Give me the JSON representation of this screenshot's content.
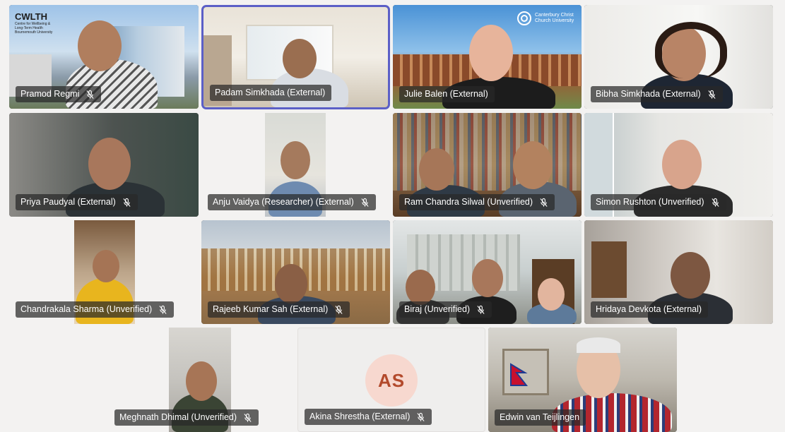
{
  "participants": [
    {
      "name": "Pramod Regmi",
      "muted": true
    },
    {
      "name": "Padam Simkhada (External)",
      "muted": false,
      "active_speaker": true
    },
    {
      "name": "Julie Balen (External)",
      "muted": false
    },
    {
      "name": "Bibha Simkhada (External)",
      "muted": true
    },
    {
      "name": "Priya Paudyal (External)",
      "muted": true
    },
    {
      "name": "Anju Vaidya (Researcher) (External)",
      "muted": true
    },
    {
      "name": "Ram Chandra Silwal (Unverified)",
      "muted": true
    },
    {
      "name": "Simon Rushton (Unverified)",
      "muted": true
    },
    {
      "name": "Chandrakala Sharma (Unverified)",
      "muted": true
    },
    {
      "name": "Rajeeb Kumar Sah (External)",
      "muted": true
    },
    {
      "name": "Biraj (Unverified)",
      "muted": true
    },
    {
      "name": "Hridaya Devkota (External)",
      "muted": false
    },
    {
      "name": "Meghnath Dhimal (Unverified)",
      "muted": true
    },
    {
      "name": "Akina Shrestha (External)",
      "muted": true,
      "initials": "AS"
    },
    {
      "name": "Edwin van Teijlingen",
      "muted": false
    }
  ],
  "logos": {
    "cwlth": "CWLTH",
    "cwlth_sub": "Centre for Wellbeing & Long-Term Health Bournemouth University",
    "canterbury": "Canterbury Christ Church University"
  },
  "colors": {
    "active_border": "#5b5fc7",
    "avatar_bg": "#f7d8cf",
    "avatar_text": "#b34a2c"
  }
}
